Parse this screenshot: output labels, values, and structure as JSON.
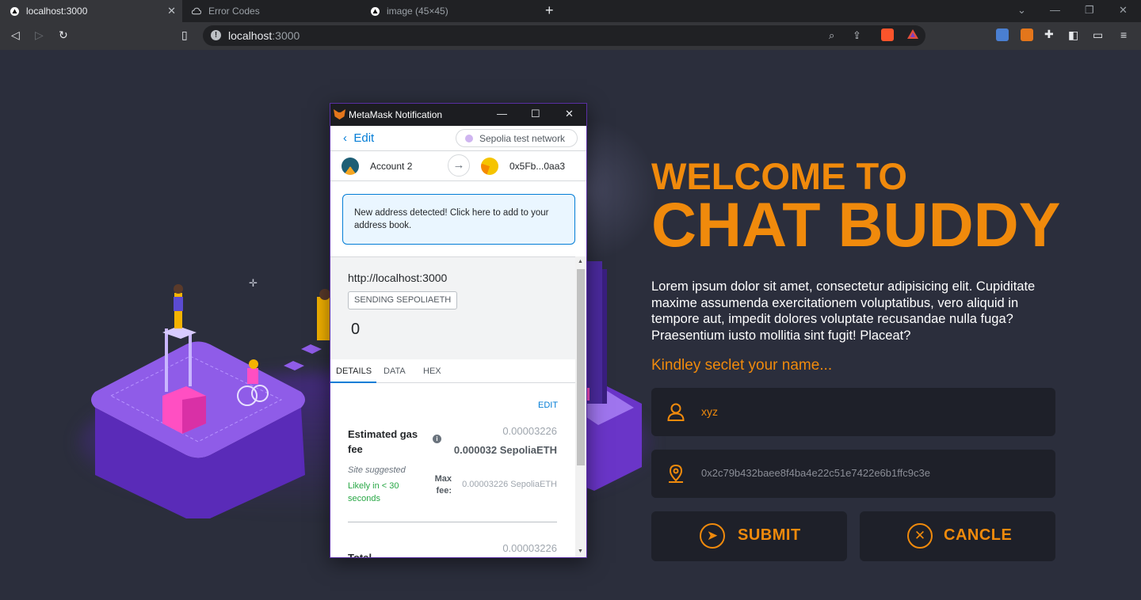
{
  "browser": {
    "tabs": [
      {
        "title": "localhost:3000",
        "active": true
      },
      {
        "title": "Error Codes",
        "active": false
      },
      {
        "title": "image (45×45)",
        "active": false
      }
    ],
    "url_host": "localhost",
    "url_port": ":3000"
  },
  "metamask": {
    "window_title": "MetaMask Notification",
    "edit_label": "Edit",
    "network": "Sepolia test network",
    "from_account": "Account 2",
    "to_address": "0x5Fb...0aa3",
    "notice": "New address detected! Click here to add to your address book.",
    "origin": "http://localhost:3000",
    "tag": "SENDING SEPOLIAETH",
    "amount": "0",
    "tabs": [
      "DETAILS",
      "DATA",
      "HEX"
    ],
    "edit_link": "EDIT",
    "gas_label": "Estimated gas fee",
    "gas_value_secondary": "0.00003226",
    "gas_value_primary": "0.000032 SepoliaETH",
    "site_suggested": "Site suggested",
    "likely": "Likely in < 30 seconds",
    "max_fee_label": "Max fee:",
    "max_fee_value": "0.00003226 SepoliaETH",
    "total_label": "Total",
    "total_value": "0.00003226"
  },
  "page": {
    "welcome_line1": "WELCOME TO",
    "welcome_line2": "CHAT BUDDY",
    "description": "Lorem ipsum dolor sit amet, consectetur adipisicing elit. Cupiditate maxime assumenda exercitationem voluptatibus, vero aliquid in tempore aut, impedit dolores voluptate recusandae nulla fuga? Praesentium iusto mollitia sint fugit! Placeat?",
    "prompt": "Kindley seclet your name...",
    "name_value": "xyz",
    "address_value": "0x2c79b432baee8f4ba4e22c51e7422e6b1ffc9c3e",
    "submit_label": "SUBMIT",
    "cancel_label": "CANCLE",
    "accent_color": "#f08a0c"
  }
}
